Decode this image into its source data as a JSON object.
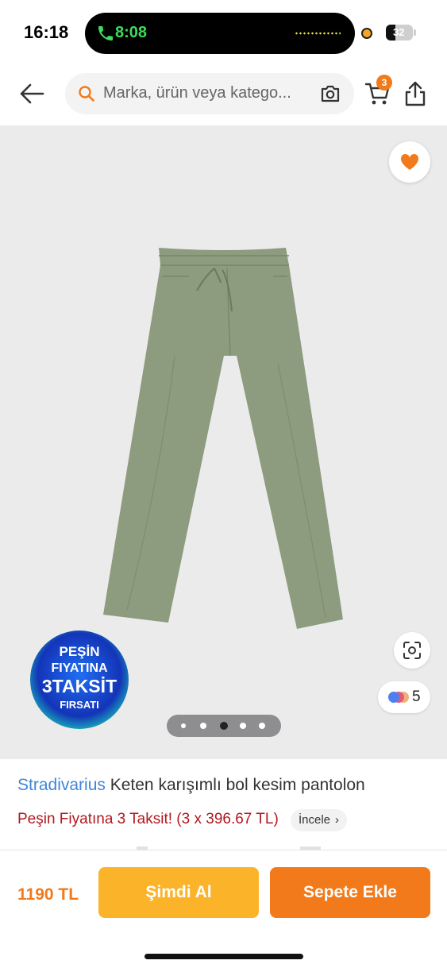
{
  "status_bar": {
    "time": "16:18",
    "call_time": "8:08",
    "battery": "32"
  },
  "header": {
    "search_placeholder": "Marka, ürün veya katego...",
    "cart_count": "3"
  },
  "gallery": {
    "promo_badge": {
      "line1": "PEŞİN",
      "line2": "FIYATINA",
      "line3": "3TAKSİT",
      "line4": "FIRSATI"
    },
    "variants_count": "5",
    "pager": {
      "count": 5,
      "active_index": 2
    }
  },
  "product": {
    "brand": "Stradivarius",
    "name": "Keten karışımlı bol kesim pantolon",
    "installment_text": "Peşin Fiyatına 3 Taksit! (3 x 396.67 TL)",
    "inspect_label": "İncele"
  },
  "bottom_bar": {
    "price": "1190 TL",
    "buy_now_label": "Şimdi Al",
    "add_to_cart_label": "Sepete Ekle"
  },
  "colors": {
    "brand_orange": "#f27a1a",
    "buy_now_yellow": "#fbb42a",
    "brand_blue": "#3f86d8",
    "installment_red": "#b3181d",
    "product_green": "#8d9b7e"
  }
}
